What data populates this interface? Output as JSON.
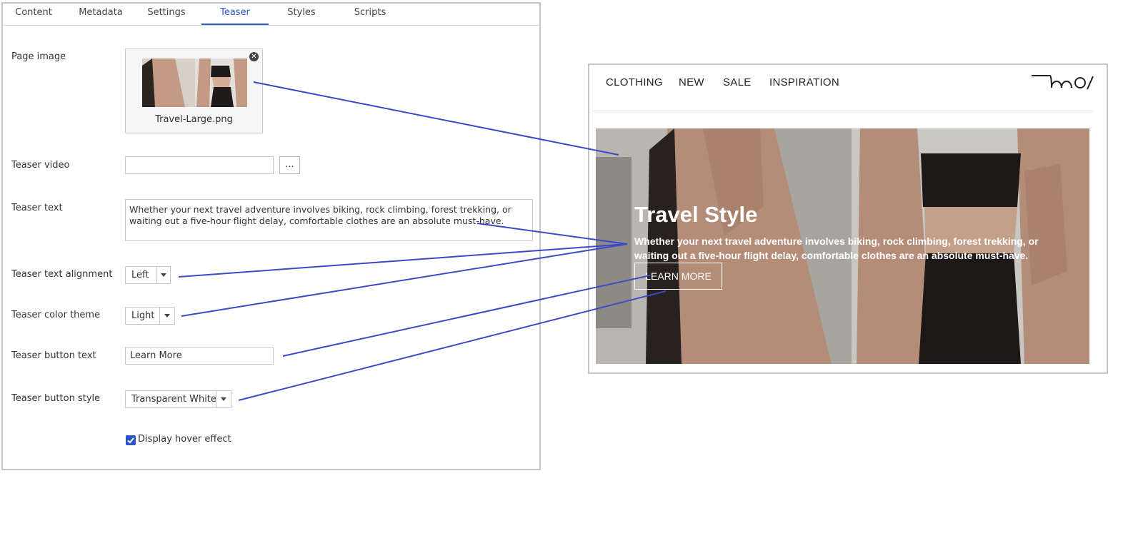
{
  "tabs": [
    {
      "label": "Content",
      "active": false
    },
    {
      "label": "Metadata",
      "active": false
    },
    {
      "label": "Settings",
      "active": false
    },
    {
      "label": "Teaser",
      "active": true
    },
    {
      "label": "Styles",
      "active": false
    },
    {
      "label": "Scripts",
      "active": false
    }
  ],
  "form": {
    "page_image": {
      "label": "Page image",
      "filename": "Travel-Large.png"
    },
    "teaser_video": {
      "label": "Teaser video",
      "value": "",
      "browse_label": "..."
    },
    "teaser_text": {
      "label": "Teaser text",
      "value": "Whether your next travel adventure involves biking, rock climbing, forest trekking, or waiting out a five-hour flight delay, comfortable clothes are an absolute must-have."
    },
    "text_alignment": {
      "label": "Teaser text alignment",
      "value": "Left"
    },
    "color_theme": {
      "label": "Teaser color theme",
      "value": "Light"
    },
    "button_text": {
      "label": "Teaser button text",
      "value": "Learn More"
    },
    "button_style": {
      "label": "Teaser button style",
      "value": "Transparent White"
    },
    "hover_effect": {
      "label": "Display hover effect",
      "checked": true
    }
  },
  "preview": {
    "nav": [
      "CLOTHING",
      "NEW",
      "SALE",
      "INSPIRATION"
    ],
    "hero": {
      "title": "Travel Style",
      "text": "Whether your next travel adventure involves biking, rock climbing, forest trekking, or waiting out a five-hour flight delay, comfortable clothes are an absolute must-have.",
      "button": "LEARN MORE"
    }
  },
  "colors": {
    "accent": "#2e55c8",
    "connector": "#3b49c8",
    "panel_border": "#c6c6c6",
    "jacket": "#c49a84"
  }
}
